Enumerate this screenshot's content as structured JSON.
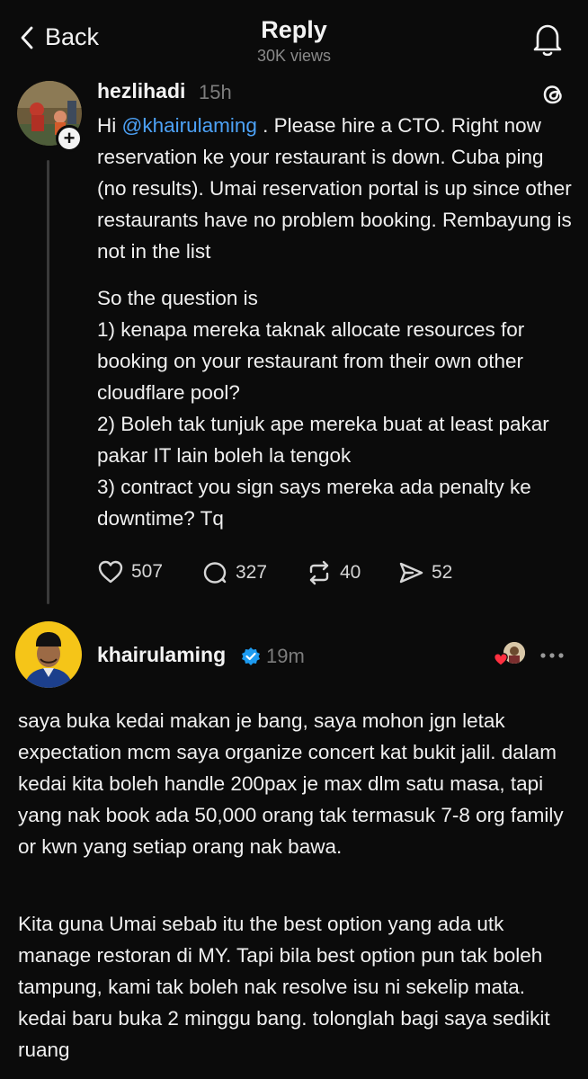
{
  "header": {
    "back_label": "Back",
    "title": "Reply",
    "views": "30K views"
  },
  "post": {
    "username": "hezlihadi",
    "time": "15h",
    "follow_symbol": "+",
    "text_prefix": "Hi ",
    "mention": "@khairulaming",
    "text_suffix": " . Please hire a CTO. Right now reservation ke your restaurant is down. Cuba ping (no results). Umai reservation portal is up since other restaurants have no problem booking. Rembayung is not in the list",
    "paragraph2": "So the question is\n1) kenapa mereka taknak allocate resources for booking on your restaurant from their own other cloudflare pool?\n2) Boleh tak tunjuk ape mereka buat at least pakar pakar IT lain boleh la tengok\n3) contract you sign says mereka ada penalty ke downtime? Tq",
    "likes": "507",
    "comments": "327",
    "reposts": "40",
    "shares": "52"
  },
  "reply": {
    "username": "khairulaming",
    "time": "19m",
    "paragraph1": "saya buka kedai makan je bang, saya mohon jgn letak expectation mcm saya organize concert kat bukit jalil. dalam kedai kita boleh handle 200pax je max dlm satu masa, tapi yang nak book ada 50,000 orang tak termasuk 7-8 org family or kwn yang setiap orang nak bawa.",
    "paragraph2": "Kita guna Umai sebab itu the best option yang ada utk manage restoran di MY. Tapi bila best option pun tak boleh tampung, kami tak boleh nak resolve isu ni sekelip mata. kedai baru buka 2 minggu bang. tolonglah bagi saya sedikit ruang"
  },
  "colors": {
    "background": "#0b0b0b",
    "mention": "#4da2f7",
    "verified": "#1d9bf0",
    "liked_heart": "#ff3040"
  },
  "icons": [
    "chevron-left-icon",
    "bell-icon",
    "threads-logo-icon",
    "heart-icon",
    "comment-icon",
    "repost-icon",
    "share-icon",
    "verified-badge-icon",
    "more-icon"
  ]
}
